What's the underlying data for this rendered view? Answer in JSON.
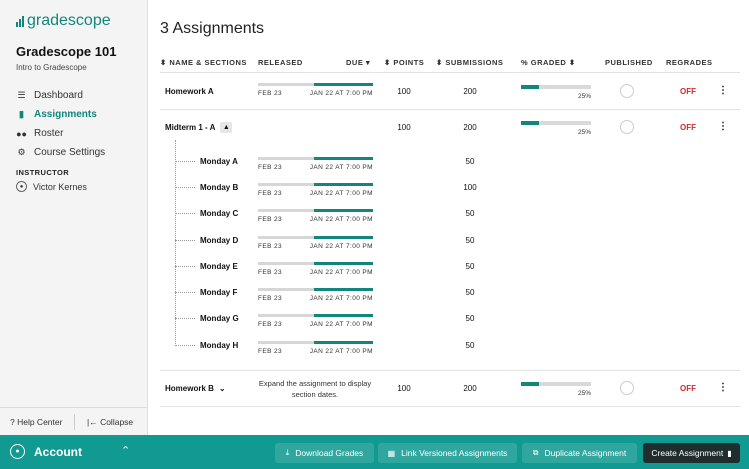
{
  "brand": {
    "logo_text": "gradescope"
  },
  "course": {
    "name": "Gradescope 101",
    "subtitle": "Intro to Gradescope"
  },
  "nav": [
    {
      "label": "Dashboard",
      "icon": "dashboard-icon",
      "active": false
    },
    {
      "label": "Assignments",
      "icon": "assignment-icon",
      "active": true
    },
    {
      "label": "Roster",
      "icon": "roster-icon",
      "active": false
    },
    {
      "label": "Course Settings",
      "icon": "gear-icon",
      "active": false
    }
  ],
  "instructor": {
    "heading": "INSTRUCTOR",
    "name": "Victor Kernes"
  },
  "sidebar_footer": {
    "help": "? Help Center",
    "collapse": "|← Collapse"
  },
  "page": {
    "title": "3 Assignments"
  },
  "columns": {
    "name": "⬍ NAME & SECTIONS",
    "released": "RELEASED",
    "due": "DUE ▾",
    "points": "⬍ POINTS",
    "submissions": "⬍ SUBMISSIONS",
    "graded": "% GRADED ⬍",
    "published": "PUBLISHED",
    "regrades": "REGRADES"
  },
  "assignments": [
    {
      "name": "Homework A",
      "released": "FEB 23",
      "due": "JAN 22 AT 7:00 PM",
      "points": "100",
      "submissions": "200",
      "graded_pct": 25,
      "graded_label": "25%",
      "regrades": "OFF"
    },
    {
      "name": "Midterm 1 - A",
      "points": "100",
      "submissions": "200",
      "graded_pct": 25,
      "graded_label": "25%",
      "regrades": "OFF",
      "sections": [
        {
          "name": "Monday A",
          "released": "FEB 23",
          "due": "JAN 22 AT 7:00 PM",
          "submissions": "50"
        },
        {
          "name": "Monday B",
          "released": "FEB 23",
          "due": "JAN 22 AT 7:00 PM",
          "submissions": "100"
        },
        {
          "name": "Monday C",
          "released": "FEB 23",
          "due": "JAN 22 AT 7:00 PM",
          "submissions": "50"
        },
        {
          "name": "Monday D",
          "released": "FEB 23",
          "due": "JAN 22 AT 7:00 PM",
          "submissions": "50"
        },
        {
          "name": "Monday E",
          "released": "FEB 23",
          "due": "JAN 22 AT 7:00 PM",
          "submissions": "50"
        },
        {
          "name": "Monday F",
          "released": "FEB 23",
          "due": "JAN 22 AT 7:00 PM",
          "submissions": "50"
        },
        {
          "name": "Monday G",
          "released": "FEB 23",
          "due": "JAN 22 AT 7:00 PM",
          "submissions": "50"
        },
        {
          "name": "Monday H",
          "released": "FEB 23",
          "due": "JAN 22 AT 7:00 PM",
          "submissions": "50"
        }
      ]
    },
    {
      "name": "Homework B",
      "note": "Expand the assignment to display section dates.",
      "points": "100",
      "submissions": "200",
      "graded_pct": 25,
      "graded_label": "25%",
      "regrades": "OFF"
    }
  ],
  "footer": {
    "account": "Account",
    "buttons": {
      "download": "Download Grades",
      "link": "Link Versioned Assignments",
      "duplicate": "Duplicate Assignment",
      "create": "Create Assignment"
    }
  },
  "colors": {
    "accent": "#14857d",
    "footer_bg": "#119a92",
    "off": "#d12b2b"
  }
}
